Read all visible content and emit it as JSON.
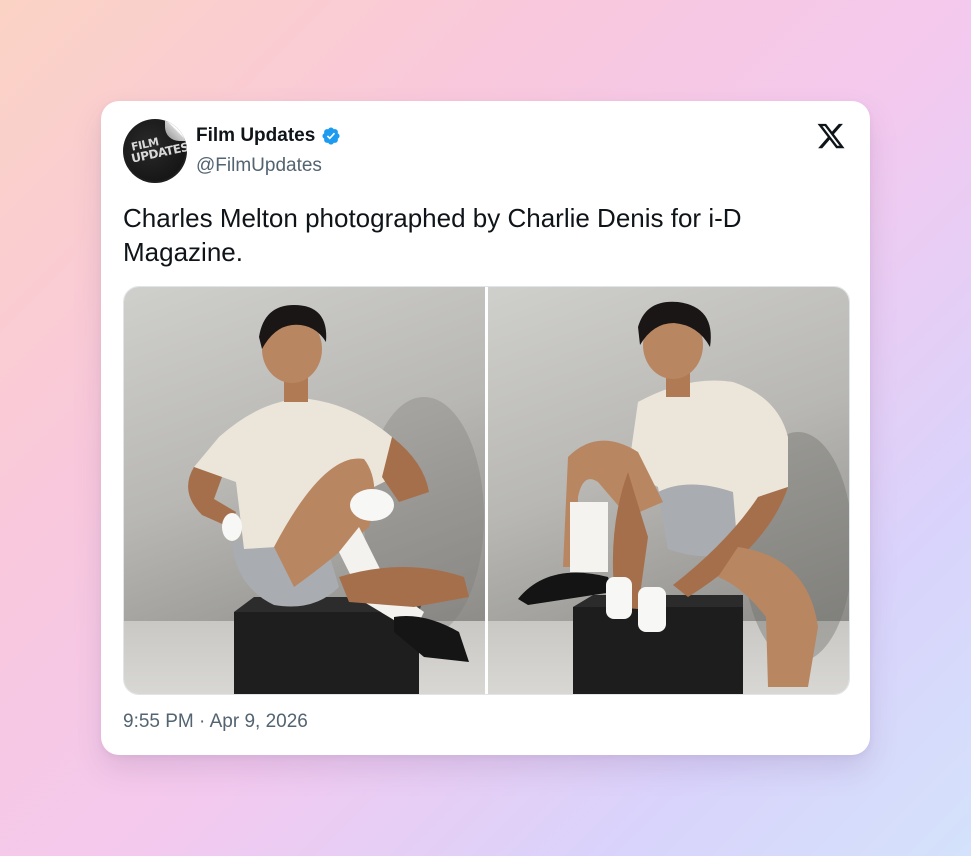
{
  "tweet": {
    "author_name": "Film Updates",
    "author_handle": "@FilmUpdates",
    "avatar_text_line1": "FILM",
    "avatar_text_line2": "UPDATES",
    "verified": true,
    "text": "Charles Melton photographed by Charlie Denis for i-D Magazine.",
    "timestamp": "9:55 PM · Apr 9, 2026",
    "media": [
      {
        "description": "photo-left"
      },
      {
        "description": "photo-right"
      }
    ]
  },
  "icons": {
    "verified": "verified-badge-icon",
    "brand": "x-logo-icon"
  },
  "colors": {
    "verified_blue": "#1d9bf0",
    "text_primary": "#0f1419",
    "text_secondary": "#536471"
  }
}
